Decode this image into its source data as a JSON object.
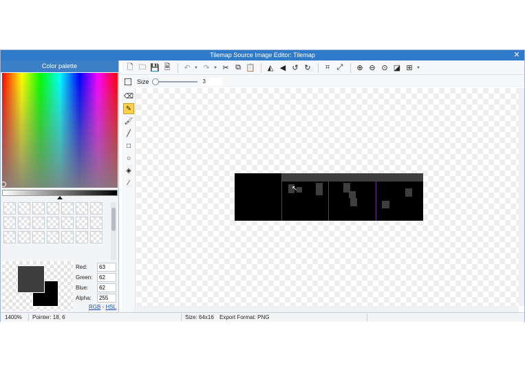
{
  "window": {
    "title": "Tilemap Source Image Editor: Tilemap",
    "close_label": "✕"
  },
  "palette": {
    "header": "Color palette",
    "swatch_count": 21,
    "channels": [
      {
        "label": "Red:",
        "value": "63"
      },
      {
        "label": "Green:",
        "value": "62"
      },
      {
        "label": "Blue:",
        "value": "62"
      },
      {
        "label": "Alpha:",
        "value": "255"
      }
    ],
    "modes": {
      "rgb": "RGB",
      "separator": "-",
      "hsl": "HSL"
    },
    "primary_color": "#3f3e3e",
    "secondary_color": "#000000"
  },
  "toolbar": {
    "icons": [
      "new-file-icon",
      "open-folder-icon",
      "save-icon",
      "export-icon",
      "undo-icon",
      "redo-icon",
      "cut-icon",
      "copy-icon",
      "paste-icon",
      "flip-horizontal-icon",
      "flip-vertical-icon",
      "rotate-left-icon",
      "rotate-right-icon",
      "crop-icon",
      "resize-icon",
      "zoom-in-icon",
      "zoom-out-icon",
      "zoom-reset-icon",
      "toggle-transparency-icon",
      "grid-icon"
    ]
  },
  "brush": {
    "size_label": "Size",
    "size_value": "3"
  },
  "tools": [
    "eraser",
    "pencil",
    "brush",
    "line",
    "rectangle",
    "ellipse",
    "fill-bucket",
    "eyedropper"
  ],
  "active_tool": "pencil",
  "status": {
    "zoom": "1400%",
    "pointer": "Pointer: 18, 6",
    "size": "Size: 64x16",
    "export_format": "Export Format: PNG"
  },
  "colors": {
    "title_bar": "#2f7ac9",
    "palette_header": "#3b7fc6",
    "active_tool": "#ffd24a",
    "tile_divider": "#6a2a8c"
  }
}
